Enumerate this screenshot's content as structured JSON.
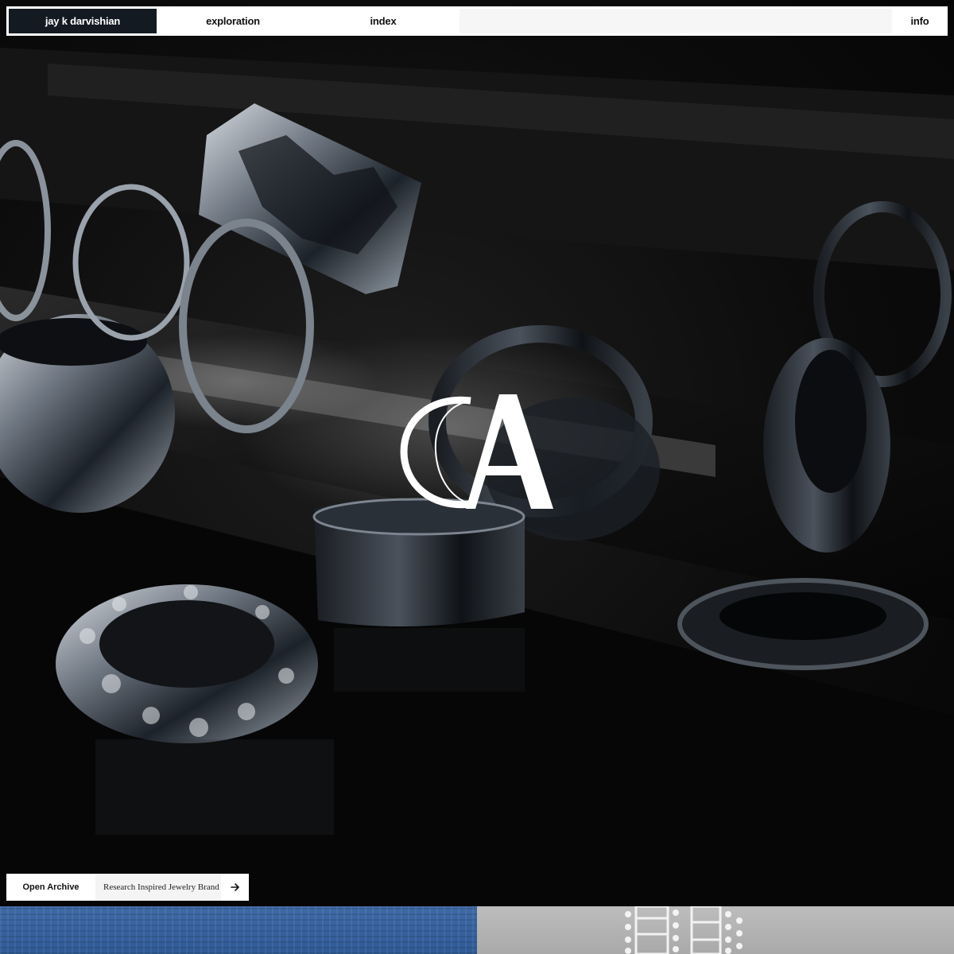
{
  "nav": {
    "brand": "jay k darvishian",
    "exploration": "exploration",
    "index": "index",
    "info": "info"
  },
  "hero": {
    "logo_letters": "CA",
    "alt_subject": "black and silver rings on reflective surface"
  },
  "cta": {
    "open_label": "Open Archive",
    "description": "Research Inspired Jewelry Brand",
    "arrow_icon": "arrow-right-icon"
  },
  "colors": {
    "nav_brand_bg": "#131a22",
    "nav_bg": "#ffffff",
    "hero_bg": "#0a0a0a",
    "tile_left": "#3f6aa6",
    "tile_right": "#bdbdbd"
  }
}
